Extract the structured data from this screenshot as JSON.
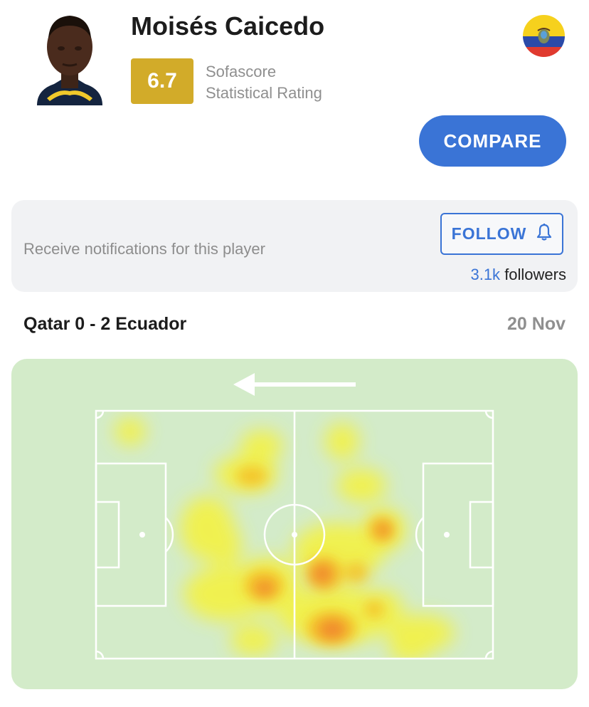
{
  "player": {
    "name": "Moisés Caicedo",
    "country_flag": "ecuador-flag-icon",
    "rating": "6.7",
    "rating_source_line1": "Sofascore",
    "rating_source_line2": "Statistical Rating"
  },
  "actions": {
    "compare_label": "COMPARE"
  },
  "follow": {
    "prompt": "Receive notifications for this player",
    "button_label": "FOLLOW",
    "followers_count": "3.1k",
    "followers_label": "followers"
  },
  "match": {
    "title": "Qatar 0 - 2 Ecuador",
    "date": "20 Nov"
  },
  "heatmap": {
    "attack_direction": "left",
    "icons": [
      "arrow-left-icon",
      "bell-icon"
    ]
  },
  "colors": {
    "accent": "#3a74d6",
    "rating_gold": "#d2ab29",
    "pitch": "#d3ebc9",
    "card_bg": "#f1f2f4"
  }
}
